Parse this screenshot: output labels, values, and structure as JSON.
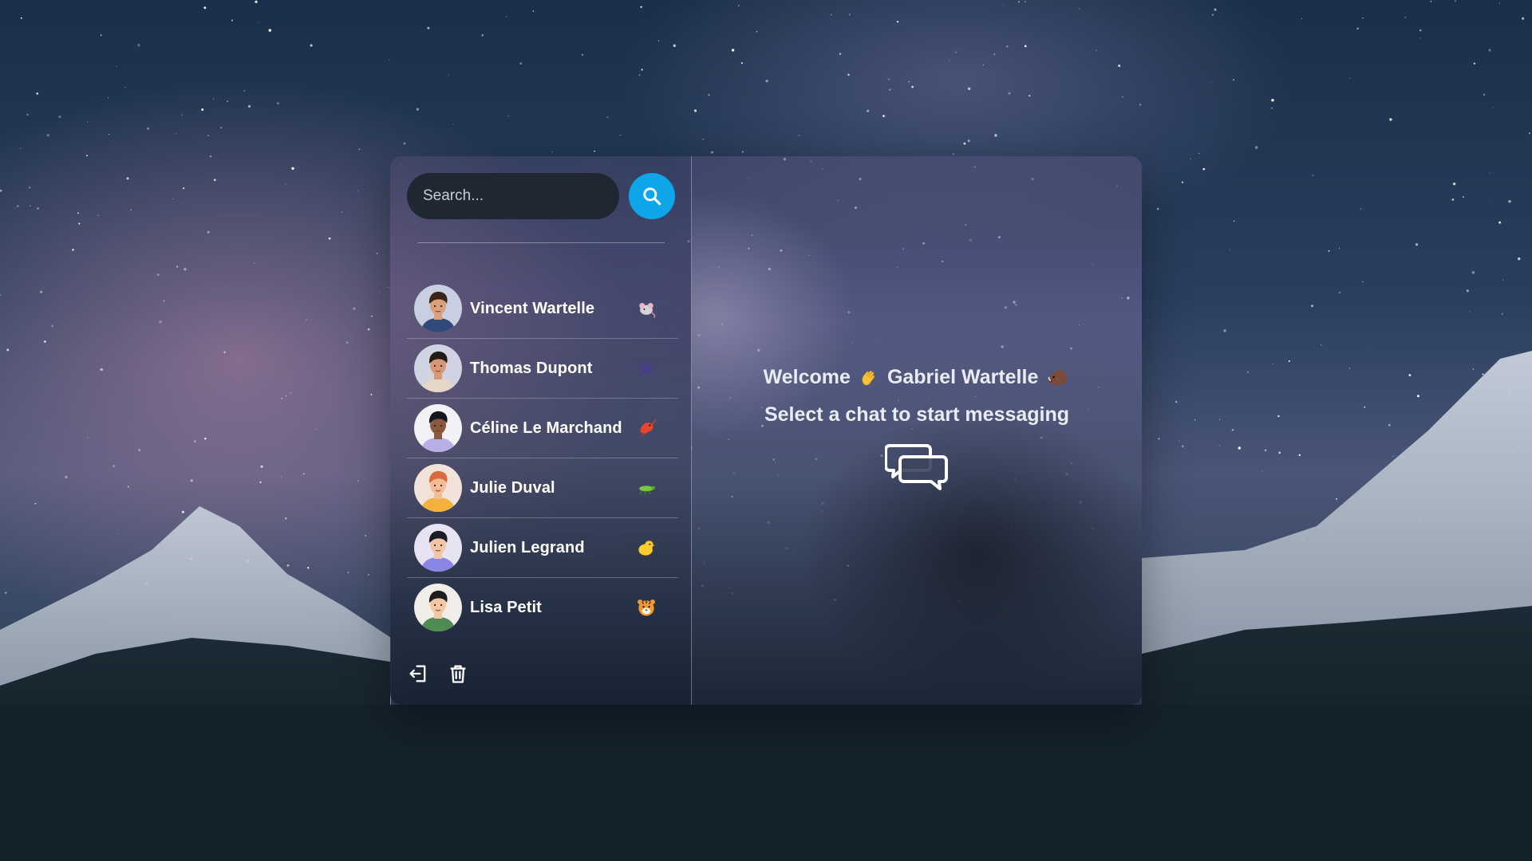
{
  "search": {
    "placeholder": "Search..."
  },
  "contacts": [
    {
      "name": "Vincent Wartelle",
      "emoji": "rat-emoji",
      "shirt": "#324a7a",
      "hair": "#3a2418",
      "skin": "#d9a07a",
      "bg": "#c8cfe0"
    },
    {
      "name": "Thomas Dupont",
      "emoji": "spider-emoji",
      "shirt": "#e6d6c8",
      "hair": "#231a17",
      "skin": "#d59872",
      "bg": "#cfd3e2"
    },
    {
      "name": "Céline Le Marchand",
      "emoji": "shrimp-emoji",
      "shirt": "#b9aee6",
      "hair": "#12161f",
      "skin": "#8a5a3e",
      "bg": "#f2f1f5"
    },
    {
      "name": "Julie Duval",
      "emoji": "cricket-emoji",
      "shirt": "#f4b23c",
      "hair": "#d86a3e",
      "skin": "#f3bb96",
      "bg": "#f1e3d9"
    },
    {
      "name": "Julien Legrand",
      "emoji": "chick-emoji",
      "shirt": "#8a86e6",
      "hair": "#1b1b27",
      "skin": "#f0c6a6",
      "bg": "#e8e3f2"
    },
    {
      "name": "Lisa Petit",
      "emoji": "tiger-emoji",
      "shirt": "#4e8c54",
      "hair": "#1c1d21",
      "skin": "#f2c7a3",
      "bg": "#f1ede8"
    }
  ],
  "welcome": {
    "prefix": "Welcome",
    "wave_emoji": "waving-hand-emoji",
    "user_name": "Gabriel Wartelle",
    "user_emoji": "boar-emoji",
    "subtitle": "Select a chat to start messaging"
  },
  "colors": {
    "accent": "#0ea5e9",
    "input_bg": "#1f2733"
  },
  "icons": {
    "logout": "logout-icon",
    "delete": "trash-icon",
    "search": "search-icon",
    "chat": "chat-bubbles-icon"
  }
}
